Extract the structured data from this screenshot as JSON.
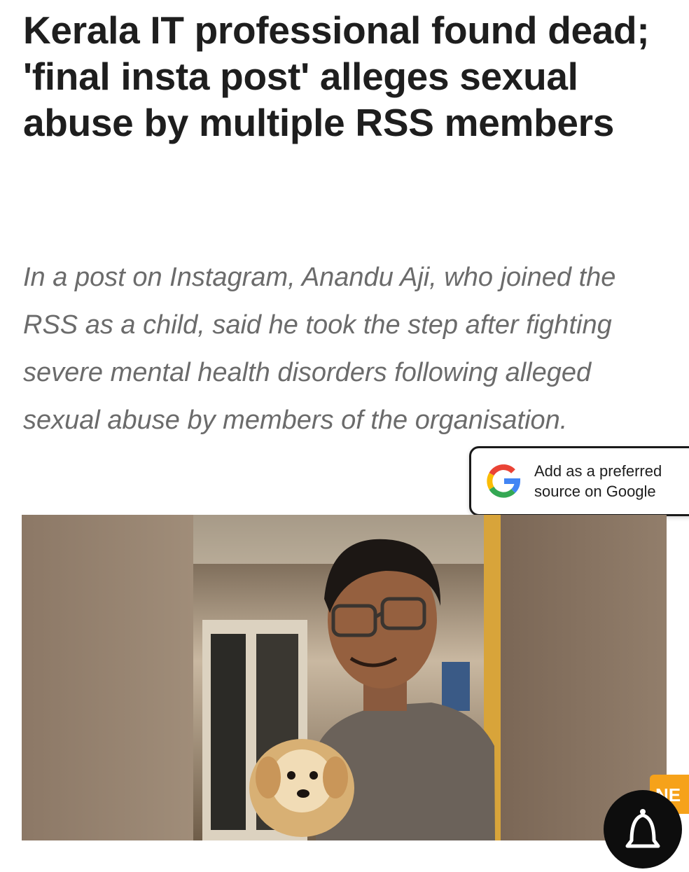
{
  "article": {
    "headline": "Kerala IT professional found dead; 'final insta post' alleges sexual abuse by multiple RSS members",
    "dek": "In a post on Instagram, Anandu Aji, who joined the RSS as a child, said he took the step after fighting severe mental health disorders following alleged sexual abuse by members of the organisation."
  },
  "google_cta": {
    "line1": "Add as a preferred",
    "line2": "source on Google",
    "icon": "google-g-icon"
  },
  "badge": {
    "label": "NE"
  },
  "notification": {
    "icon": "bell-icon"
  },
  "colors": {
    "headline": "#1e1e1e",
    "dek": "#6b6b6b",
    "badge": "#f6a21a",
    "bell_button": "#0d0d0d"
  }
}
